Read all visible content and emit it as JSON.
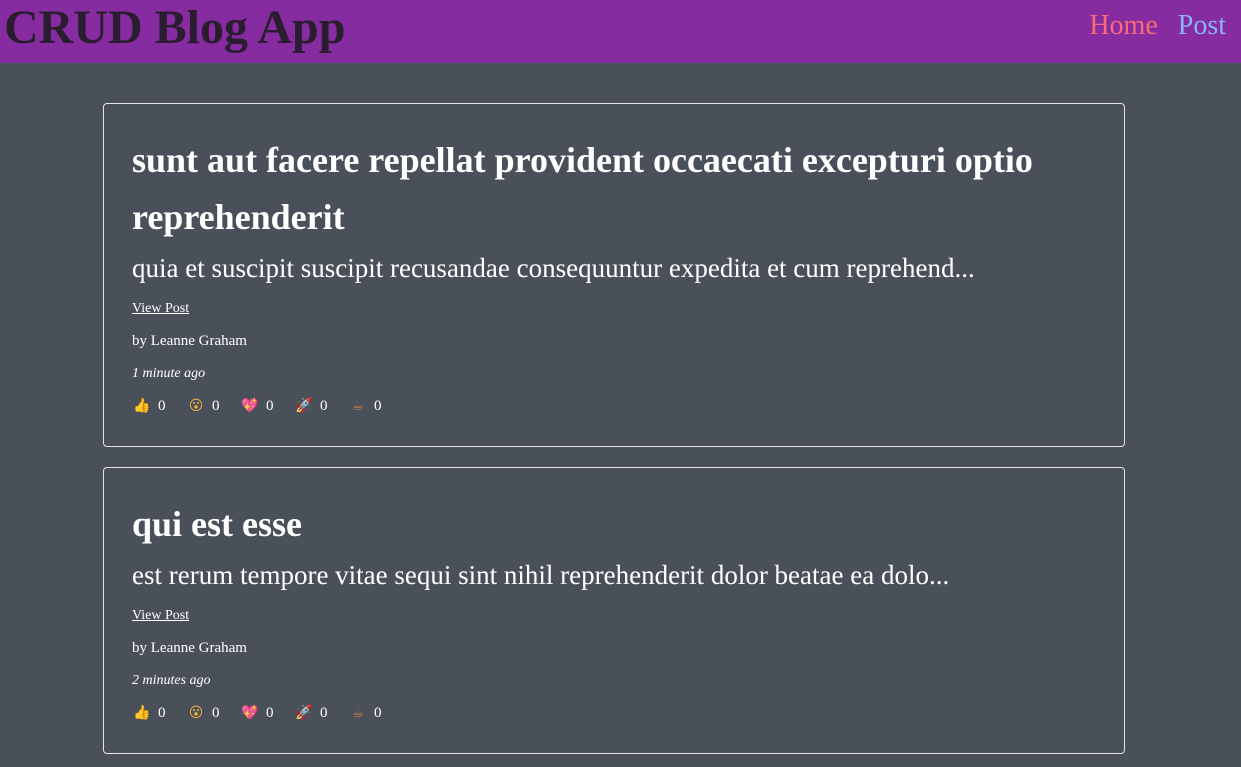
{
  "header": {
    "title": "CRUD Blog App",
    "nav": [
      {
        "label": "Home"
      },
      {
        "label": "Post"
      }
    ]
  },
  "posts": [
    {
      "title": "sunt aut facere repellat provident occaecati excepturi optio reprehenderit",
      "excerpt": "quia et suscipit suscipit recusandae consequuntur expedita et cum reprehend...",
      "view_link": "View Post",
      "author": "by Leanne Graham",
      "time": "1 minute ago",
      "reactions": [
        {
          "icon": "thumbs-up-icon",
          "glyph": "👍",
          "count": "0"
        },
        {
          "icon": "wow-icon",
          "glyph": "😮",
          "count": "0"
        },
        {
          "icon": "heart-icon",
          "glyph": "💖",
          "count": "0"
        },
        {
          "icon": "rocket-icon",
          "glyph": "🚀",
          "count": "0"
        },
        {
          "icon": "coffee-icon",
          "glyph": "☕",
          "count": "0"
        }
      ]
    },
    {
      "title": "qui est esse",
      "excerpt": "est rerum tempore vitae sequi sint nihil reprehenderit dolor beatae ea dolo...",
      "view_link": "View Post",
      "author": "by Leanne Graham",
      "time": "2 minutes ago",
      "reactions": [
        {
          "icon": "thumbs-up-icon",
          "glyph": "👍",
          "count": "0"
        },
        {
          "icon": "wow-icon",
          "glyph": "😮",
          "count": "0"
        },
        {
          "icon": "heart-icon",
          "glyph": "💖",
          "count": "0"
        },
        {
          "icon": "rocket-icon",
          "glyph": "🚀",
          "count": "0"
        },
        {
          "icon": "coffee-icon",
          "glyph": "☕",
          "count": "0"
        }
      ]
    }
  ],
  "colors": {
    "header_bg": "#872ca0",
    "page_bg": "#4a5059",
    "title": "#2a1d30",
    "nav_home": "#f86b78",
    "nav_post": "#8ab4f8"
  }
}
